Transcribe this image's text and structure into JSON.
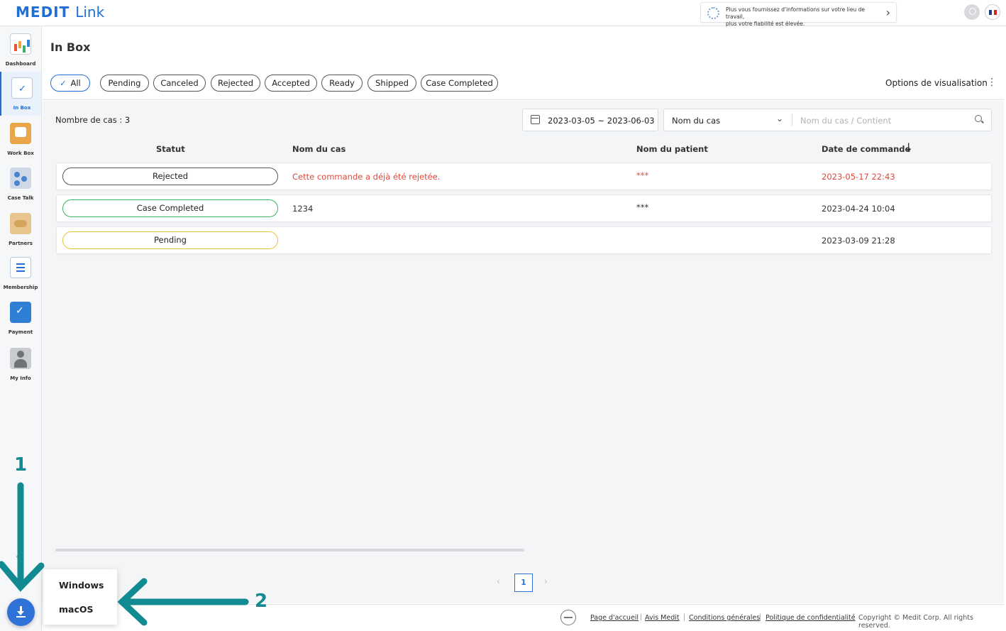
{
  "app": {
    "logo_main": "MEDIT",
    "logo_sub": "Link"
  },
  "notice": {
    "line1": "Plus vous fournissez d'informations sur votre lieu de travail,",
    "line2": "plus votre fiabilité est élevée."
  },
  "sidebar": {
    "items": [
      {
        "label": "Dashboard",
        "icon": "dashboard-icon"
      },
      {
        "label": "In Box",
        "icon": "inbox-icon",
        "active": true
      },
      {
        "label": "Work Box",
        "icon": "workbox-icon"
      },
      {
        "label": "Case Talk",
        "icon": "casetalk-icon"
      },
      {
        "label": "Partners",
        "icon": "partners-icon"
      },
      {
        "label": "Membership",
        "icon": "membership-icon"
      },
      {
        "label": "Payment",
        "icon": "payment-icon"
      },
      {
        "label": "My Info",
        "icon": "myinfo-icon"
      }
    ]
  },
  "download_menu": {
    "items": [
      "Windows",
      "macOS"
    ]
  },
  "page": {
    "title": "In Box",
    "filters": [
      "All",
      "Pending",
      "Canceled",
      "Rejected",
      "Accepted",
      "Ready",
      "Shipped",
      "Case Completed"
    ],
    "active_filter": "All",
    "view_options": "Options de visualisation"
  },
  "toolbar": {
    "count": "Nombre de cas : 3",
    "date_range": "2023-03-05 ~ 2023-06-03",
    "search_field": "Nom du cas",
    "search_placeholder": "Nom du cas / Contient"
  },
  "table": {
    "headers": [
      "Statut",
      "Nom du cas",
      "Nom du patient",
      "Date de commande"
    ],
    "rows": [
      {
        "status": "Rejected",
        "status_color": "#555555",
        "case_name": "Cette commande a déjà été rejetée.",
        "patient": "***",
        "date": "2023-05-17 22:43",
        "highlight": "#e0483c"
      },
      {
        "status": "Case Completed",
        "status_color": "#3bb35c",
        "case_name": "1234",
        "patient": "***",
        "date": "2023-04-24 10:04",
        "highlight": ""
      },
      {
        "status": "Pending",
        "status_color": "#f0c23a",
        "case_name": "",
        "patient": "",
        "date": "2023-03-09 21:28",
        "highlight": ""
      }
    ]
  },
  "pagination": {
    "current": "1"
  },
  "footer": {
    "links": [
      "Page d'accueil",
      "Avis Medit",
      "Conditions générales",
      "Politique de confidentialité"
    ],
    "copyright": "Copyright © Medit Corp. All rights reserved."
  },
  "annotations": {
    "one": "1",
    "two": "2",
    "color": "#128a91"
  }
}
